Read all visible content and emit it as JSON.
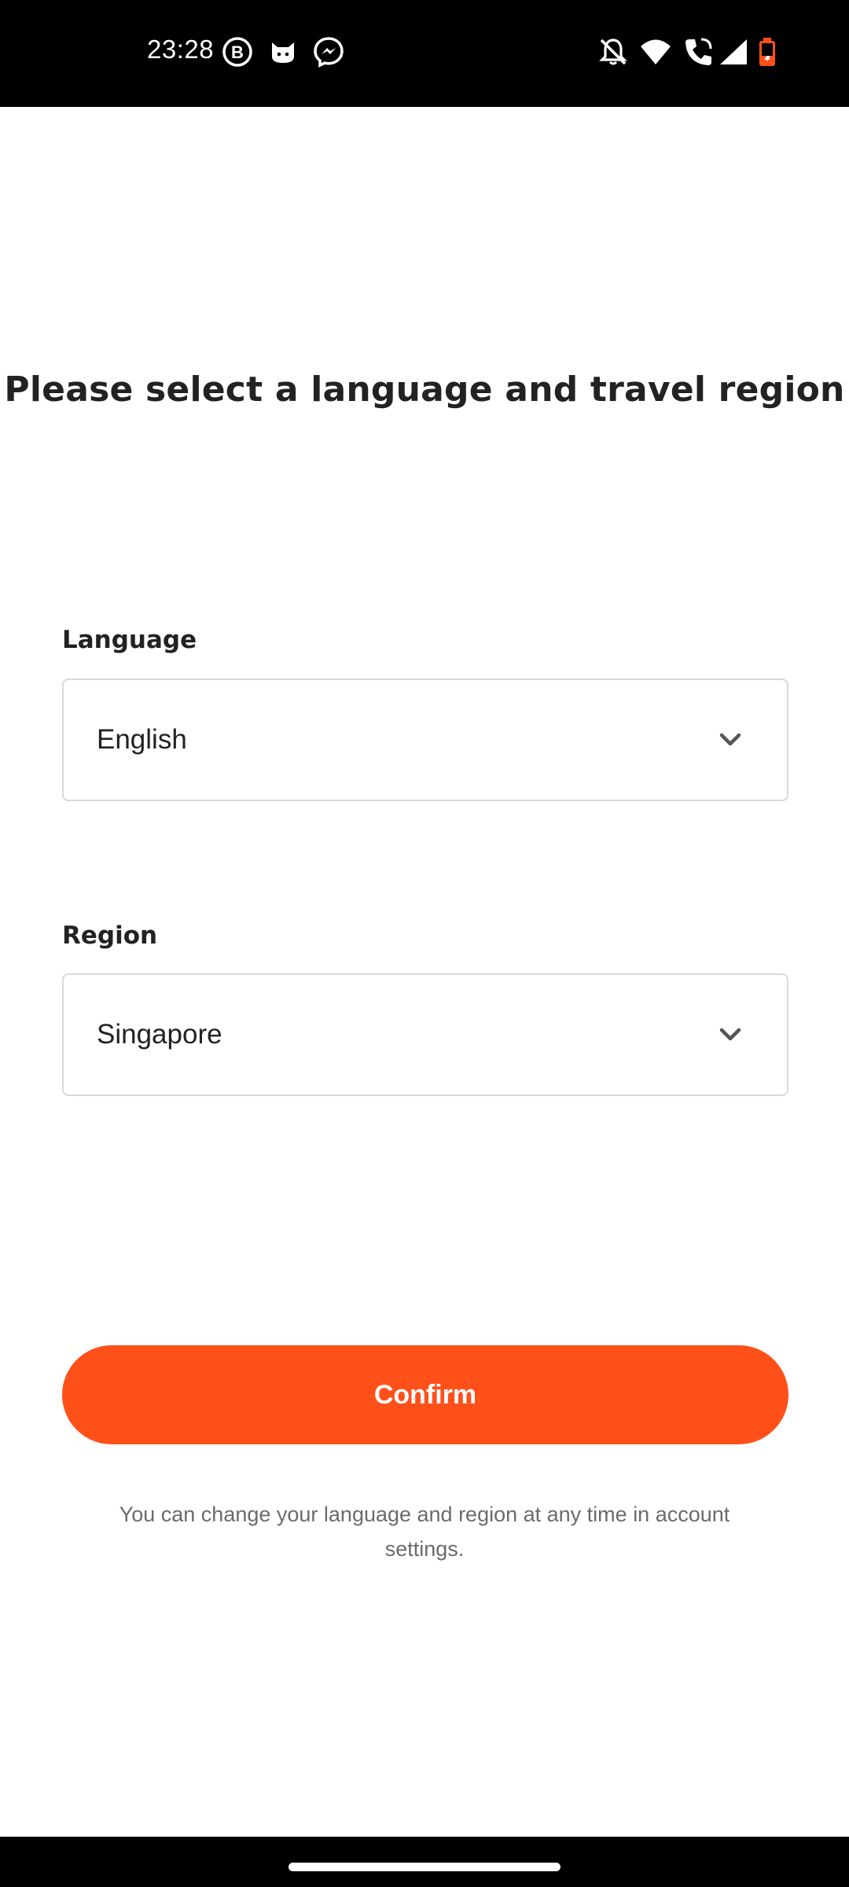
{
  "status_bar": {
    "time": "23:28",
    "left_icons": [
      "b-badge-icon",
      "cat-app-icon",
      "messenger-icon"
    ],
    "right_icons": [
      "notifications-off-icon",
      "wifi-icon",
      "wifi-calling-icon",
      "cell-signal-icon",
      "battery-icon"
    ]
  },
  "page": {
    "title": "Please select a language and travel region"
  },
  "language": {
    "label": "Language",
    "value": "English"
  },
  "region": {
    "label": "Region",
    "value": "Singapore"
  },
  "confirm_label": "Confirm",
  "footnote": "You can change your language and region at any time in account settings.",
  "colors": {
    "accent": "#ff5019",
    "text": "#222222",
    "muted": "#6b6b6b",
    "border": "#d9d9d9"
  }
}
